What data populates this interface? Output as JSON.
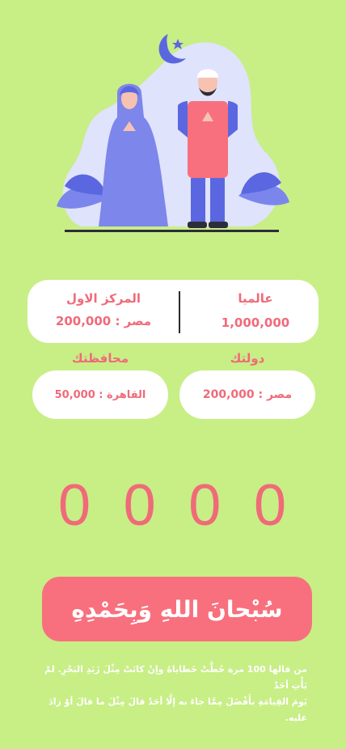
{
  "stats": {
    "world_label": "عالميا",
    "world_value": "1,000,000",
    "top_center_label": "المركز الاول",
    "top_center_value": "مصر : 200,000",
    "country_label": "دولتك",
    "country_value": "مصر : 200,000",
    "governorate_label": "محافظتك",
    "governorate_value": "القاهرة : 50,000"
  },
  "counter": {
    "digits": [
      "0",
      "0",
      "0",
      "0"
    ]
  },
  "dhikr_button": {
    "label": "سُبْحانَ اللهِ وَبِحَمْدِهِ"
  },
  "hadith": {
    "line1": "من قالها 100 مرة حُطَّتْ خَطاياهُ وإنْ كانَتْ مِثْلَ زَبَدِ البَحْرِ. لمْ يَأْتِ أحَدٌ",
    "line2": "يَومَ القِيامَةِ بأَفْضَلَ مِمَّا جاءَ به إلَّا أحَدٌ قالَ مِثْلَ ما قالَ أوْ زادَ عليه."
  },
  "colors": {
    "background": "#c8ee86",
    "accent": "#f8707d",
    "text_accent": "#f06a79"
  }
}
